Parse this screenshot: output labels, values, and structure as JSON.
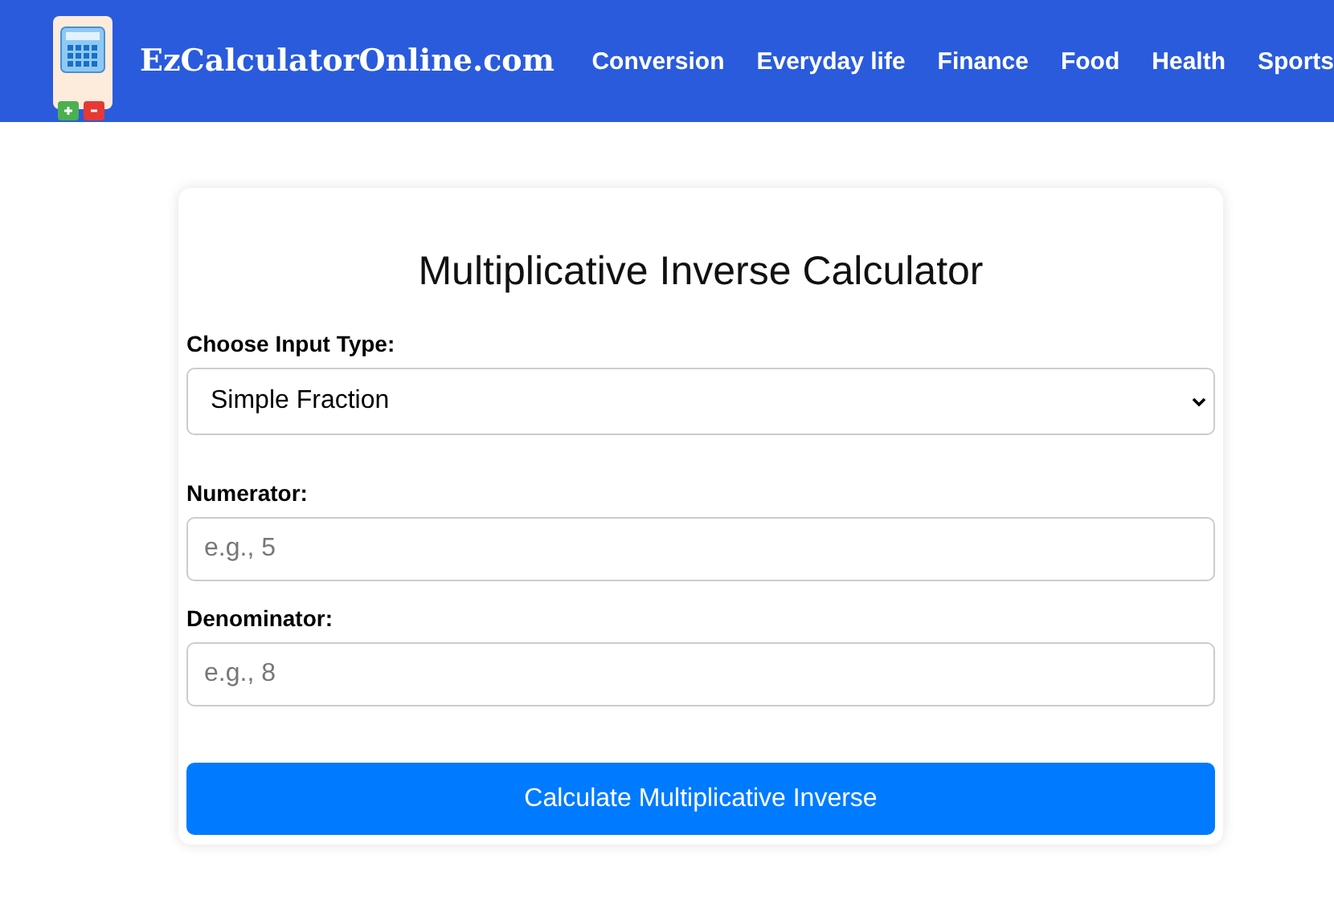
{
  "header": {
    "site_title": "EzCalculatorOnline.com",
    "nav": [
      "Conversion",
      "Everyday life",
      "Finance",
      "Food",
      "Health",
      "Sports"
    ]
  },
  "calculator": {
    "title": "Multiplicative Inverse Calculator",
    "input_type": {
      "label": "Choose Input Type:",
      "value": "Simple Fraction"
    },
    "fields": [
      {
        "label": "Numerator:",
        "placeholder": "e.g., 5"
      },
      {
        "label": "Denominator:",
        "placeholder": "e.g., 8"
      }
    ],
    "button": "Calculate Multiplicative Inverse"
  }
}
